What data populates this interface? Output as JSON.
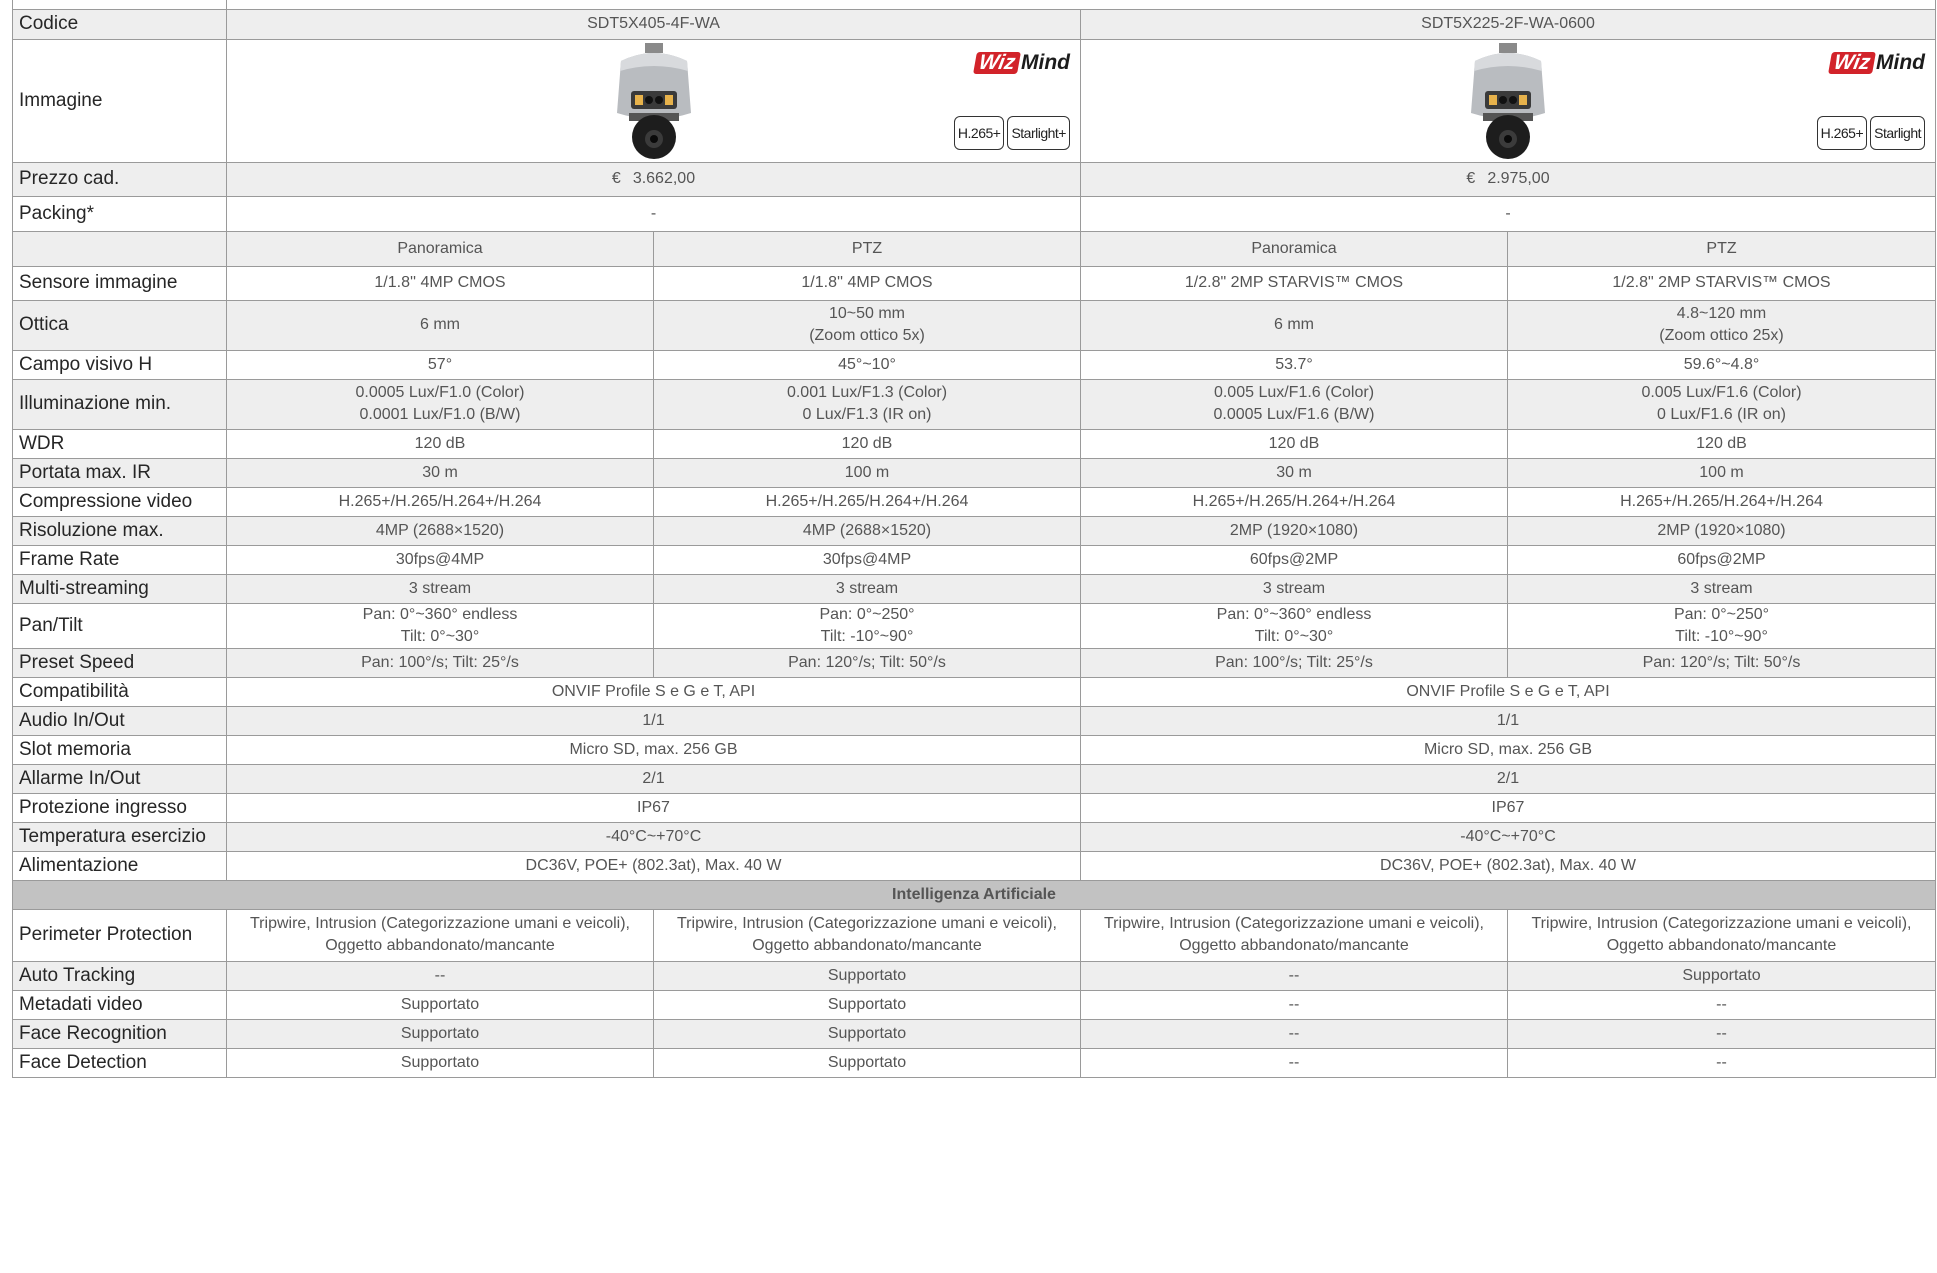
{
  "models": [
    {
      "code": "SDT5X405-4F-WA",
      "price_currency": "€",
      "price": "3.662,00",
      "packing": "-",
      "logo_prefix": "Wiz",
      "logo_suffix": "Mind",
      "badges": [
        "H.265+",
        "Starlight+"
      ]
    },
    {
      "code": "SDT5X225-2F-WA-0600",
      "price_currency": "€",
      "price": "2.975,00",
      "packing": "-",
      "logo_prefix": "Wiz",
      "logo_suffix": "Mind",
      "badges": [
        "H.265+",
        "Starlight"
      ]
    }
  ],
  "labels": {
    "code": "Codice",
    "image": "Immagine",
    "price": "Prezzo cad.",
    "packing": "Packing*"
  },
  "sub_headers": [
    "Panoramica",
    "PTZ",
    "Panoramica",
    "PTZ"
  ],
  "specs": [
    {
      "label": "Sensore immagine",
      "values": [
        "1/1.8'' 4MP CMOS",
        "1/1.8''  4MP CMOS",
        "1/2.8\" 2MP STARVIS™ CMOS",
        "1/2.8\"  2MP STARVIS™ CMOS"
      ]
    },
    {
      "label": "Ottica",
      "values": [
        "6 mm",
        "10~50 mm\n(Zoom ottico 5x)",
        "6 mm",
        "4.8~120 mm\n(Zoom ottico 25x)"
      ]
    },
    {
      "label": "Campo visivo H",
      "values": [
        "57°",
        "45°~10°",
        "53.7°",
        "59.6°~4.8°"
      ]
    },
    {
      "label": "Illuminazione min.",
      "values": [
        "0.0005 Lux/F1.0 (Color)\n0.0001 Lux/F1.0 (B/W)",
        "0.001 Lux/F1.3 (Color)\n0 Lux/F1.3 (IR on)",
        "0.005 Lux/F1.6 (Color)\n0.0005 Lux/F1.6 (B/W)",
        "0.005 Lux/F1.6 (Color)\n0 Lux/F1.6 (IR on)"
      ]
    },
    {
      "label": "WDR",
      "values": [
        "120 dB",
        "120 dB",
        "120 dB",
        "120 dB"
      ]
    },
    {
      "label": "Portata max. IR",
      "values": [
        "30 m",
        "100 m",
        "30 m",
        "100 m"
      ]
    },
    {
      "label": "Compressione video",
      "values": [
        "H.265+/H.265/H.264+/H.264",
        "H.265+/H.265/H.264+/H.264",
        "H.265+/H.265/H.264+/H.264",
        "H.265+/H.265/H.264+/H.264"
      ]
    },
    {
      "label": "Risoluzione max.",
      "values": [
        "4MP (2688×1520)",
        "4MP (2688×1520)",
        "2MP (1920×1080)",
        "2MP (1920×1080)"
      ]
    },
    {
      "label": "Frame Rate",
      "values": [
        "30fps@4MP",
        "30fps@4MP",
        "60fps@2MP",
        "60fps@2MP"
      ]
    },
    {
      "label": "Multi-streaming",
      "values": [
        "3 stream",
        "3 stream",
        "3 stream",
        "3 stream"
      ]
    },
    {
      "label": "Pan/Tilt",
      "values": [
        "Pan: 0°~360° endless\nTilt: 0°~30°",
        "Pan: 0°~250°\nTilt: -10°~90°",
        "Pan: 0°~360° endless\nTilt: 0°~30°",
        "Pan: 0°~250°\nTilt: -10°~90°"
      ]
    },
    {
      "label": "Preset Speed",
      "values": [
        "Pan: 100°/s; Tilt: 25°/s",
        "Pan: 120°/s; Tilt: 50°/s",
        "Pan: 100°/s; Tilt: 25°/s",
        "Pan: 120°/s; Tilt: 50°/s"
      ]
    }
  ],
  "specs_merged": [
    {
      "label": "Compatibilità",
      "values": [
        "ONVIF Profile S e G e T, API",
        "ONVIF Profile S e G e T, API"
      ]
    },
    {
      "label": "Audio In/Out",
      "values": [
        "1/1",
        "1/1"
      ]
    },
    {
      "label": "Slot memoria",
      "values": [
        "Micro SD, max. 256 GB",
        "Micro SD, max. 256 GB"
      ]
    },
    {
      "label": "Allarme In/Out",
      "values": [
        "2/1",
        "2/1"
      ]
    },
    {
      "label": "Protezione ingresso",
      "values": [
        "IP67",
        "IP67"
      ]
    },
    {
      "label": "Temperatura esercizio",
      "values": [
        "-40°C~+70°C",
        "-40°C~+70°C"
      ]
    },
    {
      "label": "Alimentazione",
      "values": [
        "DC36V, POE+ (802.3at), Max. 40 W",
        "DC36V, POE+ (802.3at), Max. 40 W"
      ]
    }
  ],
  "ai_section_title": "Intelligenza Artificiale",
  "ai_specs": [
    {
      "label": "Perimeter Protection",
      "values": [
        "Tripwire, Intrusion (Categorizzazione umani e veicoli),\nOggetto abbandonato/mancante",
        "Tripwire, Intrusion (Categorizzazione umani e veicoli),\nOggetto abbandonato/mancante",
        "Tripwire, Intrusion (Categorizzazione umani e veicoli),\nOggetto abbandonato/mancante",
        "Tripwire, Intrusion (Categorizzazione umani e veicoli),\nOggetto abbandonato/mancante"
      ]
    },
    {
      "label": "Auto Tracking",
      "values": [
        "--",
        "Supportato",
        "--",
        "Supportato"
      ]
    },
    {
      "label": "Metadati video",
      "values": [
        "Supportato",
        "Supportato",
        "--",
        "--"
      ]
    },
    {
      "label": "Face Recognition",
      "values": [
        "Supportato",
        "Supportato",
        "--",
        "--"
      ]
    },
    {
      "label": "Face Detection",
      "values": [
        "Supportato",
        "Supportato",
        "--",
        "--"
      ]
    }
  ],
  "colors": {
    "price_green": "#5aab3c",
    "row_alt": "#eeeeee",
    "section_header": "#c2c2c2",
    "border": "#9a9a9a",
    "wizmind_red": "#d2232a"
  }
}
